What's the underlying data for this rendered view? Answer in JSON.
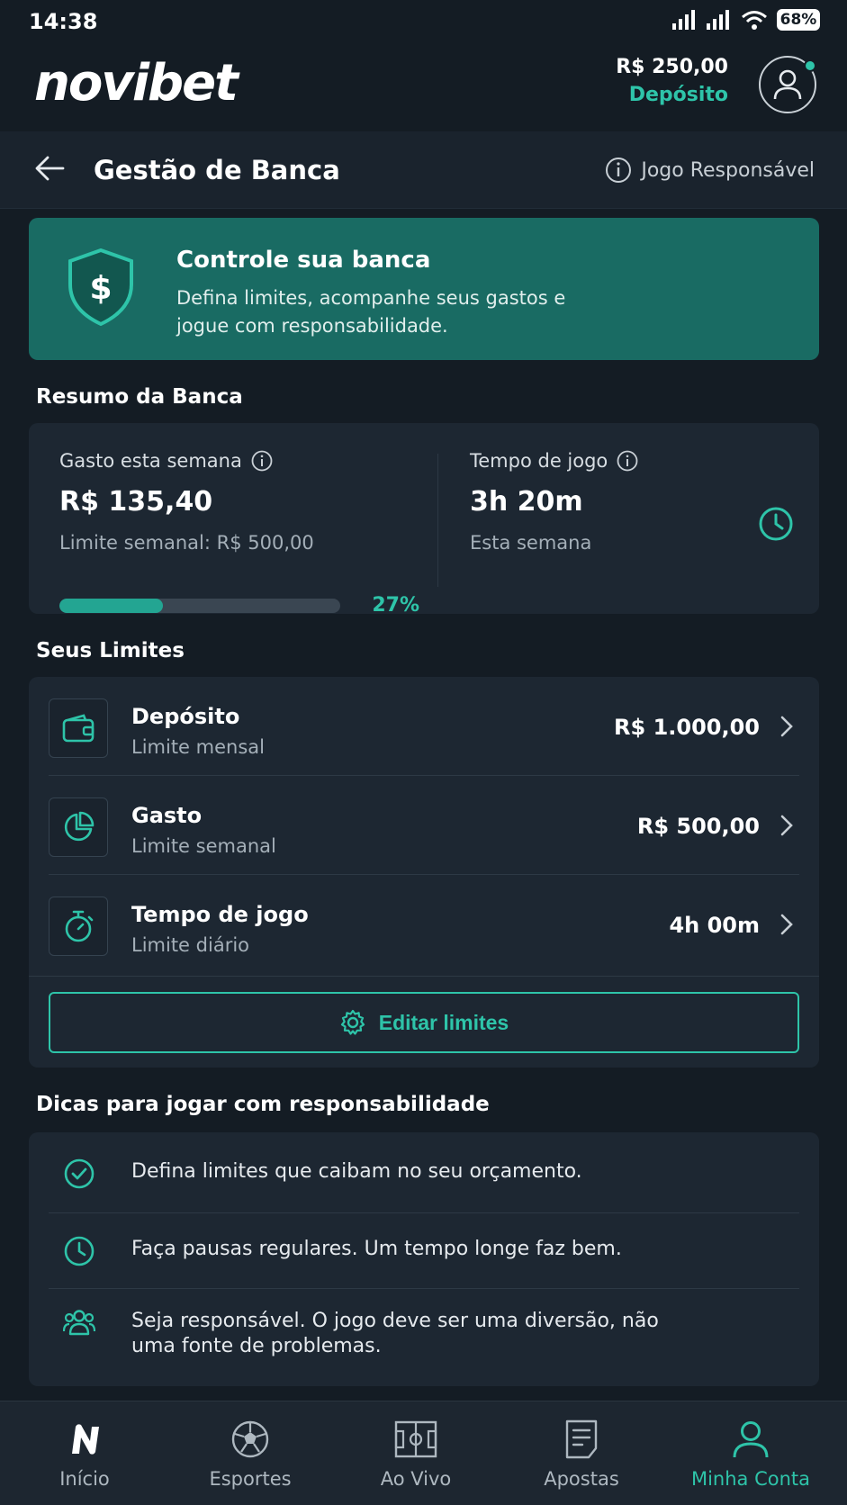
{
  "status_bar": {
    "time": "14:38",
    "battery": "68%"
  },
  "header": {
    "logo": "novibet",
    "balance": "R$ 250,00",
    "deposit_label": "Depósito"
  },
  "title_bar": {
    "title": "Gestão de Banca",
    "responsible_label": "Jogo Responsável"
  },
  "banner": {
    "title": "Controle sua banca",
    "description": "Defina limites, acompanhe seus gastos e jogue com responsabilidade."
  },
  "summary": {
    "section_title": "Resumo da Banca",
    "spent_label": "Gasto esta semana",
    "spent_value": "R$ 135,40",
    "spent_limit": "Limite semanal: R$ 500,00",
    "progress_percent": 27,
    "progress_label": "27%",
    "time_label": "Tempo de jogo",
    "time_value": "3h 20m",
    "time_sub": "Esta semana"
  },
  "limits": {
    "section_title": "Seus Limites",
    "items": [
      {
        "name": "Depósito",
        "sub": "Limite mensal",
        "value": "R$ 1.000,00",
        "icon": "wallet-icon"
      },
      {
        "name": "Gasto",
        "sub": "Limite semanal",
        "value": "R$ 500,00",
        "icon": "pie-chart-icon"
      },
      {
        "name": "Tempo de jogo",
        "sub": "Limite diário",
        "value": "4h 00m",
        "icon": "stopwatch-icon"
      }
    ],
    "edit_label": "Editar limites"
  },
  "tips": {
    "section_title": "Dicas para jogar com responsabilidade",
    "items": [
      {
        "text": "Defina limites que caibam no seu orçamento.",
        "icon": "check-circle-icon"
      },
      {
        "text": "Faça pausas regulares. Um tempo longe faz bem.",
        "icon": "clock-icon"
      },
      {
        "text": "Seja responsável. O jogo deve ser uma diversão, não uma fonte de problemas.",
        "icon": "users-icon"
      }
    ]
  },
  "bottom_nav": {
    "items": [
      {
        "label": "Início"
      },
      {
        "label": "Esportes"
      },
      {
        "label": "Ao Vivo"
      },
      {
        "label": "Apostas"
      },
      {
        "label": "Minha Conta"
      }
    ],
    "active_index": 4
  },
  "colors": {
    "accent": "#2ec4a9",
    "background": "#141c24",
    "card": "#1d2732",
    "banner": "#196b63"
  }
}
